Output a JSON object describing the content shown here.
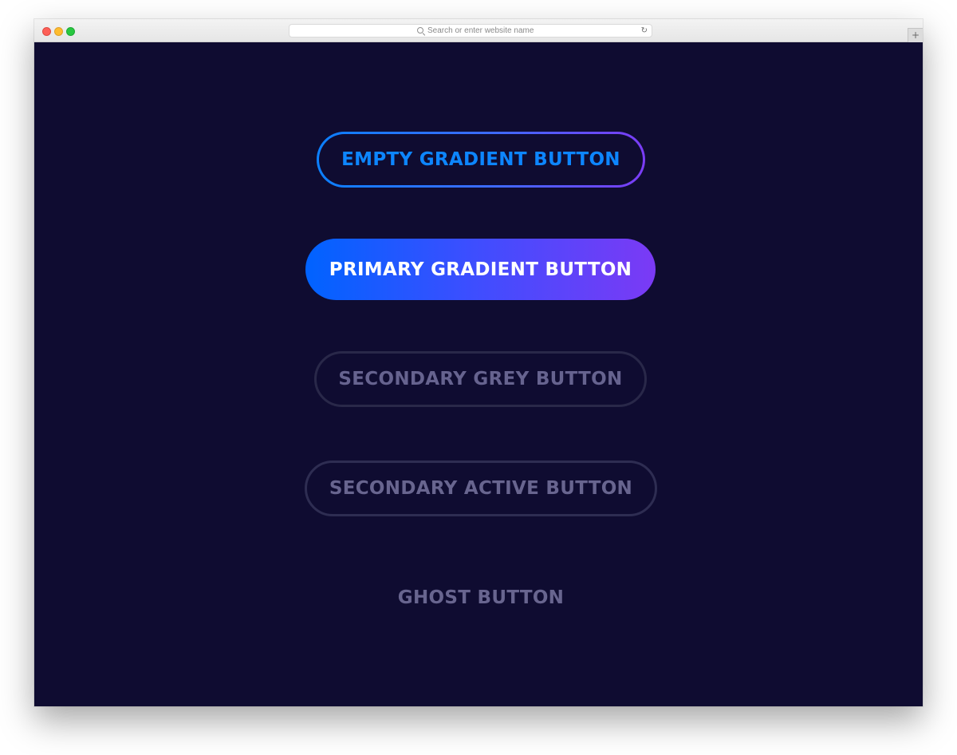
{
  "browser": {
    "address_placeholder": "Search or enter website name",
    "reload_icon": "reload-icon",
    "new_tab_icon": "plus-icon",
    "new_tab_glyph": "+"
  },
  "buttons": {
    "empty_gradient": "EMPTY GRADIENT BUTTON",
    "primary_gradient": "PRIMARY GRADIENT BUTTON",
    "secondary_grey": "SECONDARY GREY BUTTON",
    "secondary_active": "SECONDARY ACTIVE BUTTON",
    "ghost": "GHOST BUTTON"
  },
  "colors": {
    "background": "#0f0c31",
    "gradient_start": "#0063ff",
    "gradient_end": "#7b3af5",
    "empty_text": "#0d86ff",
    "muted_text": "#66638f",
    "muted_border": "#292849"
  }
}
